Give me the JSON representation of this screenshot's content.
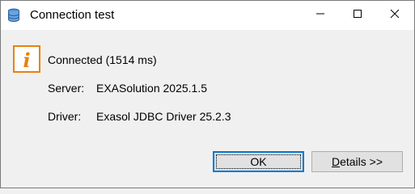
{
  "window": {
    "title": "Connection test",
    "icon": "database-icon",
    "controls": {
      "minimize": "minimize-icon",
      "maximize": "maximize-icon",
      "close": "close-icon"
    }
  },
  "message": {
    "icon": "info-icon",
    "status": "Connected (1514 ms)",
    "rows": [
      {
        "label": "Server:",
        "value": "EXASolution 2025.1.5"
      },
      {
        "label": "Driver:",
        "value": "Exasol JDBC Driver 25.2.3"
      }
    ]
  },
  "buttons": {
    "ok_label": "OK",
    "details_mnemonic": "D",
    "details_rest": "etails >>"
  },
  "colors": {
    "info_orange": "#e8820c",
    "focus_blue": "#0078d7"
  }
}
